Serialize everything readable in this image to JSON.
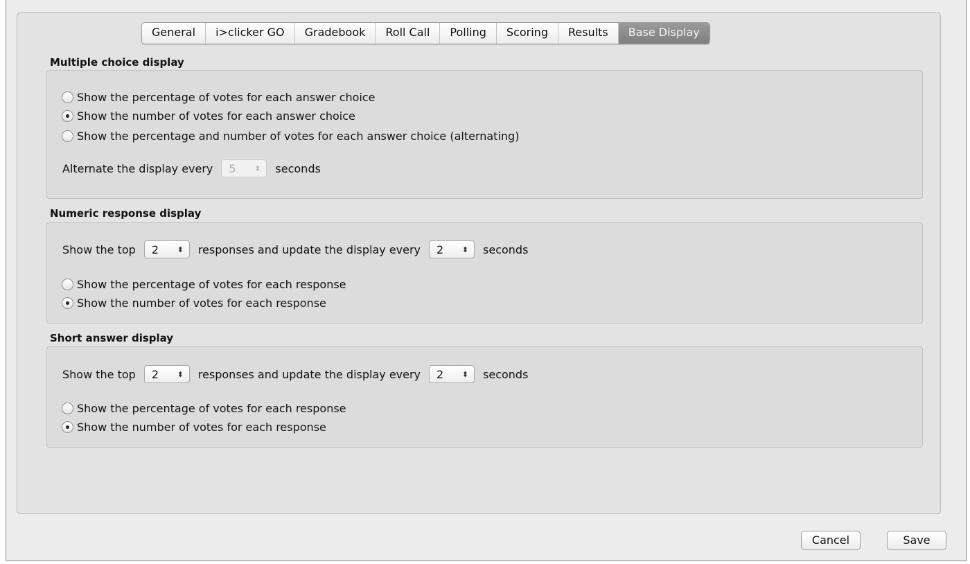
{
  "tabs": [
    "General",
    "i>clicker GO",
    "Gradebook",
    "Roll Call",
    "Polling",
    "Scoring",
    "Results",
    "Base Display"
  ],
  "active_tab": "Base Display",
  "multiple_choice": {
    "title": "Multiple choice display",
    "options": [
      {
        "label": "Show the percentage of votes for each answer choice",
        "checked": false
      },
      {
        "label": "Show the number of votes for each answer choice",
        "checked": true
      },
      {
        "label": "Show the percentage and number of votes for each answer choice (alternating)",
        "checked": false
      }
    ],
    "alternate_prefix": "Alternate the display every",
    "alternate_value": "5",
    "alternate_suffix": "seconds"
  },
  "numeric": {
    "title": "Numeric response display",
    "show_top_prefix": "Show the top",
    "top_value": "2",
    "middle_text": "responses and update the display every",
    "update_value": "2",
    "suffix": "seconds",
    "options": [
      {
        "label": "Show the percentage of votes for each response",
        "checked": false
      },
      {
        "label": "Show the number of votes for each response",
        "checked": true
      }
    ]
  },
  "short_answer": {
    "title": "Short answer display",
    "show_top_prefix": "Show the top",
    "top_value": "2",
    "middle_text": "responses and update the display every",
    "update_value": "2",
    "suffix": "seconds",
    "options": [
      {
        "label": "Show the percentage of votes for each response",
        "checked": false
      },
      {
        "label": "Show the number of votes for each response",
        "checked": true
      }
    ]
  },
  "buttons": {
    "cancel": "Cancel",
    "save": "Save"
  }
}
